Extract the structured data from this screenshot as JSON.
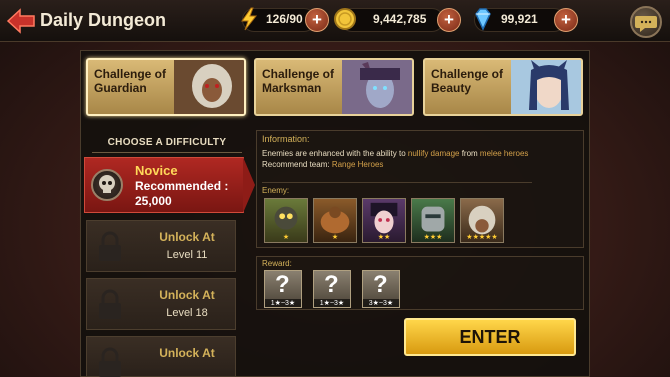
{
  "header": {
    "title": "Daily Dungeon"
  },
  "resources": {
    "stamina": {
      "value": "126/90",
      "icon": "lightning-icon"
    },
    "gold": {
      "value": "9,442,785",
      "icon": "gold-coin-icon"
    },
    "gems": {
      "value": "99,921",
      "icon": "diamond-icon"
    },
    "plus_label": "+"
  },
  "challenges": [
    {
      "label": "Challenge of Guardian",
      "selected": true
    },
    {
      "label": "Challenge of Marksman",
      "selected": false
    },
    {
      "label": "Challenge of Beauty",
      "selected": false
    }
  ],
  "difficulty": {
    "header": "CHOOSE A DIFFICULTY",
    "selected": {
      "name": "Novice",
      "recommended_label": "Recommended :",
      "recommended_value": "25,000"
    },
    "locked": [
      {
        "title": "Unlock At",
        "level": "Level 11"
      },
      {
        "title": "Unlock At",
        "level": "Level 18"
      },
      {
        "title": "Unlock At",
        "level": ""
      }
    ]
  },
  "information": {
    "title": "Information:",
    "line1_prefix": "Enemies are enhanced with the ability to ",
    "line1_hl1": "nullify damage",
    "line1_mid": " from ",
    "line1_hl2": "melee heroes",
    "line2_prefix": "Recommend team: ",
    "line2_hl": "Range Heroes"
  },
  "enemy": {
    "label": "Enemy:",
    "portraits": [
      {
        "stars": "★"
      },
      {
        "stars": "★"
      },
      {
        "stars": "★★"
      },
      {
        "stars": "★★★"
      },
      {
        "stars": "★★★★★"
      }
    ]
  },
  "reward": {
    "label": "Reward:",
    "items": [
      {
        "range": "1★~3★"
      },
      {
        "range": "1★~3★"
      },
      {
        "range": "3★~3★"
      }
    ]
  },
  "enter_label": "ENTER",
  "colors": {
    "accent_gold": "#d4b25a",
    "novice_red": "#b02822",
    "enter_yellow": "#ffd64a"
  }
}
